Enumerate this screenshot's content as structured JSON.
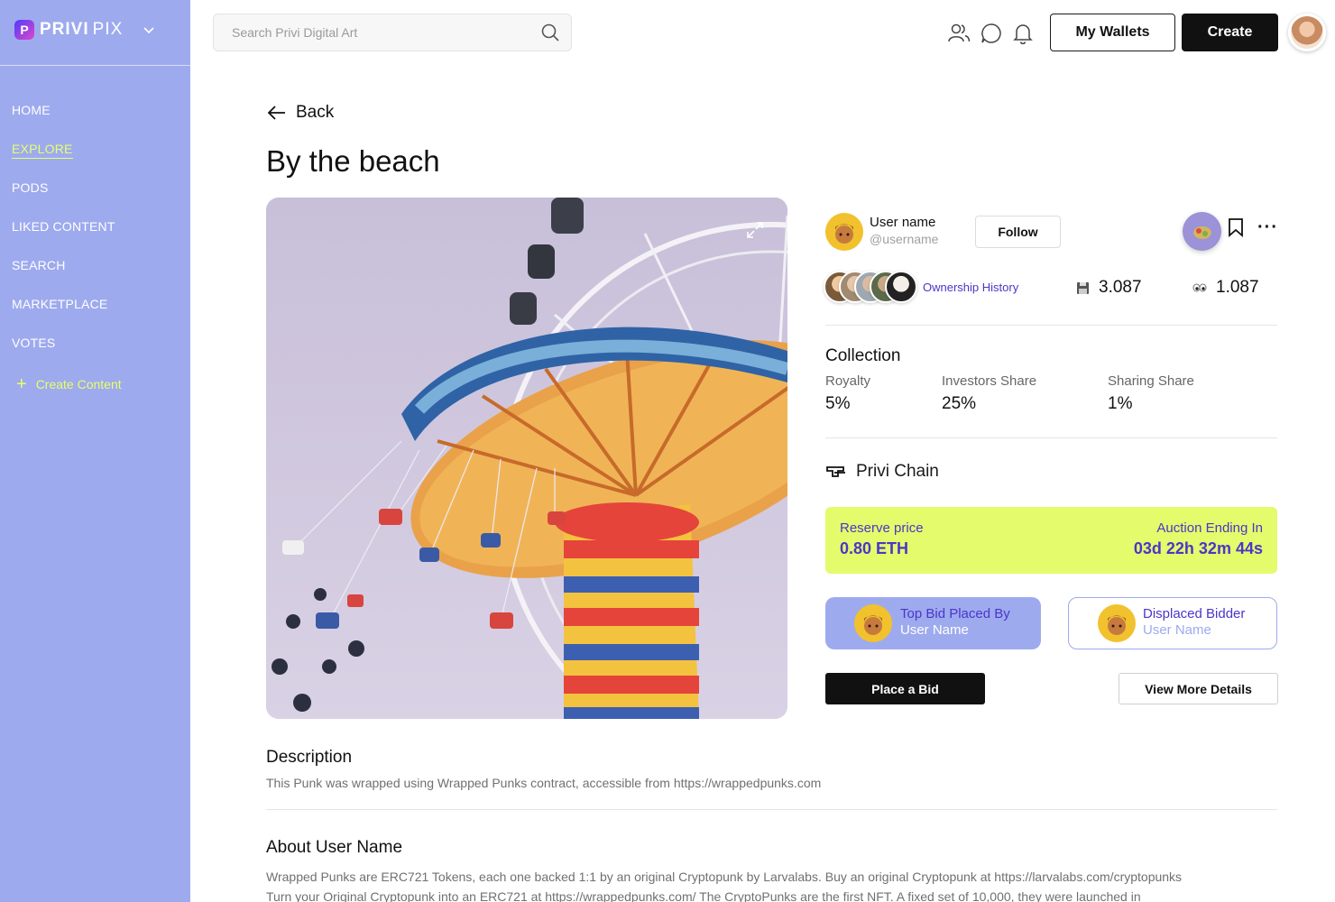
{
  "sidebar": {
    "brand_bold": "PRIVI",
    "brand_light": "PIX",
    "items": [
      {
        "label": "HOME"
      },
      {
        "label": "EXPLORE"
      },
      {
        "label": "PODS"
      },
      {
        "label": "LIKED CONTENT"
      },
      {
        "label": "SEARCH"
      },
      {
        "label": "MARKETPLACE"
      },
      {
        "label": "VOTES"
      }
    ],
    "active_item": "EXPLORE",
    "create_content": "Create Content"
  },
  "header": {
    "search_placeholder": "Search Privi Digital Art",
    "wallets_label": "My Wallets",
    "create_label": "Create",
    "icons": [
      "people-icon",
      "chat-icon",
      "bell-icon"
    ]
  },
  "main": {
    "back_label": "Back",
    "title": "By the beach"
  },
  "creator": {
    "name": "User name",
    "handle": "@username",
    "follow_label": "Follow"
  },
  "ownership": {
    "history_label": "Ownership History",
    "saves": "3.087",
    "views": "1.087"
  },
  "collection": {
    "title": "Collection",
    "royalty_label": "Royalty",
    "royalty_value": "5%",
    "investors_label": "Investors Share",
    "investors_value": "25%",
    "sharing_label": "Sharing Share",
    "sharing_value": "1%"
  },
  "chain": {
    "label": "Privi Chain"
  },
  "auction": {
    "reserve_label": "Reserve price",
    "reserve_value": "0.80 ETH",
    "ending_label": "Auction Ending In",
    "ending_value": "03d 22h 32m 44s"
  },
  "bids": {
    "top_label": "Top Bid Placed By",
    "top_user": "User Name",
    "displaced_label": "Displaced Bidder",
    "displaced_user": "User Name"
  },
  "actions": {
    "place_bid": "Place a Bid",
    "view_more": "View More Details"
  },
  "description": {
    "title": "Description",
    "text": "This Punk was wrapped using Wrapped Punks contract, accessible from https://wrappedpunks.com"
  },
  "about": {
    "title": "About User Name",
    "line1": "Wrapped Punks are ERC721 Tokens, each one backed 1:1 by an original Cryptopunk by Larvalabs. Buy an original Cryptopunk at https://larvalabs.com/cryptopunks",
    "line2": "Turn your Original Cryptopunk into an ERC721 at https://wrappedpunks.com/ The CryptoPunks are the first NFT. A fixed set of 10,000, they were launched in"
  },
  "colors": {
    "sidebar": "#9eaaee",
    "accent_lime": "#e4fb6c",
    "accent_purple": "#4a36c9"
  }
}
